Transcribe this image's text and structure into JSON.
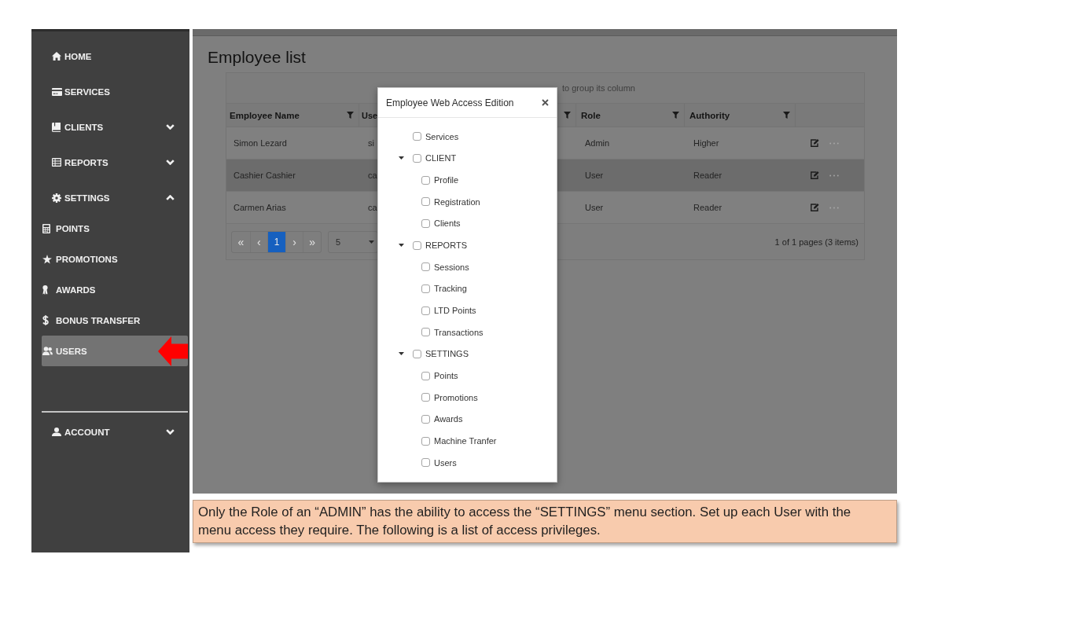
{
  "sidebar": {
    "items": [
      {
        "label": "HOME",
        "kind": "link",
        "selected": false
      },
      {
        "label": "SERVICES",
        "kind": "link",
        "selected": false
      },
      {
        "label": "CLIENTS",
        "kind": "group",
        "expanded": false,
        "selected": false
      },
      {
        "label": "REPORTS",
        "kind": "group",
        "expanded": false,
        "selected": false
      },
      {
        "label": "SETTINGS",
        "kind": "group",
        "expanded": true,
        "selected": false,
        "children": [
          {
            "label": "POINTS",
            "selected": false
          },
          {
            "label": "PROMOTIONS",
            "selected": false
          },
          {
            "label": "AWARDS",
            "selected": false
          },
          {
            "label": "BONUS TRANSFER",
            "selected": false
          },
          {
            "label": "USERS",
            "selected": true
          }
        ]
      }
    ],
    "footer_items": [
      {
        "label": "ACCOUNT",
        "kind": "group",
        "expanded": false,
        "selected": false
      }
    ]
  },
  "page": {
    "title": "Employee list"
  },
  "grid": {
    "group_panel_hint": "to group its column",
    "columns": [
      {
        "label": "Employee Name",
        "filter": true
      },
      {
        "label": "Use"
      },
      {
        "filter": true
      },
      {
        "label": "Role",
        "filter": true
      },
      {
        "label": "Authority",
        "filter": true
      }
    ],
    "rows": [
      {
        "employee_name": "Simon Lezard",
        "column_2": "si",
        "role": "Admin",
        "authority": "Higher",
        "selected": false
      },
      {
        "employee_name": "Cashier Cashier",
        "column_2": "ca",
        "role": "User",
        "authority": "Reader",
        "selected": true
      },
      {
        "employee_name": "Carmen Arias",
        "column_2": "ca",
        "role": "User",
        "authority": "Reader",
        "selected": false
      }
    ],
    "pager": {
      "buttons": [
        {
          "label": "«",
          "disabled": true,
          "selected": false
        },
        {
          "label": "‹",
          "disabled": true,
          "selected": false
        },
        {
          "label": "1",
          "disabled": false,
          "selected": true
        },
        {
          "label": "›",
          "disabled": true,
          "selected": false
        },
        {
          "label": "»",
          "disabled": true,
          "selected": false
        }
      ],
      "page_size": "5",
      "summary": "1 of 1 pages (3 items)"
    }
  },
  "modal": {
    "title": "Employee Web Access Edition",
    "tree": [
      {
        "label": "Services",
        "kind": "leaf",
        "checked": false
      },
      {
        "label": "CLIENT",
        "kind": "group",
        "expanded": true,
        "checked": false,
        "children": [
          {
            "label": "Profile",
            "checked": false
          },
          {
            "label": "Registration",
            "checked": false
          },
          {
            "label": "Clients",
            "checked": false
          }
        ]
      },
      {
        "label": "REPORTS",
        "kind": "group",
        "expanded": true,
        "checked": false,
        "children": [
          {
            "label": "Sessions",
            "checked": false
          },
          {
            "label": "Tracking",
            "checked": false
          },
          {
            "label": "LTD Points",
            "checked": false
          },
          {
            "label": "Transactions",
            "checked": false
          }
        ]
      },
      {
        "label": "SETTINGS",
        "kind": "group",
        "expanded": true,
        "checked": false,
        "children": [
          {
            "label": "Points",
            "checked": false
          },
          {
            "label": "Promotions",
            "checked": false
          },
          {
            "label": "Awards",
            "checked": false
          },
          {
            "label": "Machine Tranfer",
            "checked": false
          },
          {
            "label": "Users",
            "checked": false
          }
        ]
      }
    ]
  },
  "note": {
    "text": "Only the Role of an “ADMIN” has the ability to access the “SETTINGS” menu section. Set up each User with the menu access they require. The following is a list of access privileges."
  }
}
